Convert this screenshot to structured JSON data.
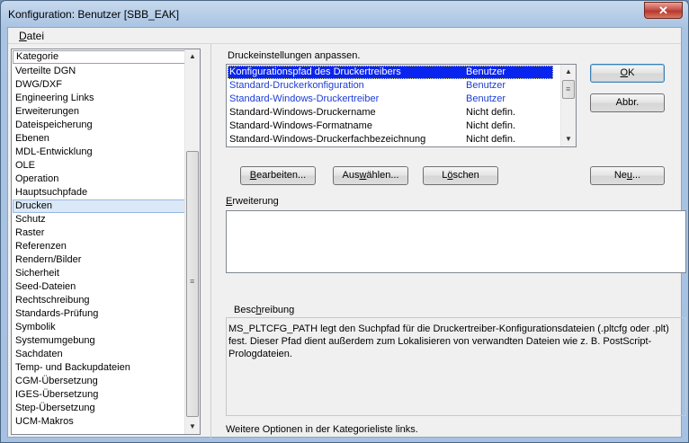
{
  "window": {
    "title": "Konfiguration: Benutzer [SBB_EAK]",
    "close_glyph": "✕"
  },
  "menu": {
    "file_mnemonic": "D",
    "file_rest": "atei"
  },
  "category": {
    "header": "Kategorie",
    "items": [
      "Verteilte DGN",
      "DWG/DXF",
      "Engineering Links",
      "Erweiterungen",
      "Dateispeicherung",
      "Ebenen",
      "MDL-Entwicklung",
      "OLE",
      "Operation",
      "Hauptsuchpfade",
      "Drucken",
      "Schutz",
      "Raster",
      "Referenzen",
      "Rendern/Bilder",
      "Sicherheit",
      "Seed-Dateien",
      "Rechtschreibung",
      "Standards-Prüfung",
      "Symbolik",
      "Systemumgebung",
      "Sachdaten",
      "Temp- und Backupdateien",
      "CGM-Übersetzung",
      "IGES-Übersetzung",
      "Step-Übersetzung",
      "UCM-Makros"
    ],
    "selected_index": 10
  },
  "settings": {
    "heading": "Druckeinstellungen anpassen.",
    "rows": [
      {
        "name": "Konfigurationspfad des Druckertreibers",
        "value": "Benutzer",
        "state": "selected"
      },
      {
        "name": "Standard-Druckerkonfiguration",
        "value": "Benutzer",
        "state": "blue"
      },
      {
        "name": "Standard-Windows-Druckertreiber",
        "value": "Benutzer",
        "state": "blue"
      },
      {
        "name": "Standard-Windows-Druckername",
        "value": "Nicht defin.",
        "state": "normal"
      },
      {
        "name": "Standard-Windows-Formatname",
        "value": "Nicht defin.",
        "state": "normal"
      },
      {
        "name": "Standard-Windows-Druckerfachbezeichnung",
        "value": "Nicht defin.",
        "state": "normal"
      }
    ]
  },
  "buttons": {
    "ok": {
      "m": "O",
      "rest": "K"
    },
    "cancel": "Abbr.",
    "edit": {
      "m": "B",
      "rest": "earbeiten..."
    },
    "select": {
      "pre": "Aus",
      "m": "w",
      "rest": "ählen..."
    },
    "delete": {
      "pre": "L",
      "m": "ö",
      "rest": "schen"
    },
    "new": {
      "pre": "Ne",
      "m": "u",
      "rest": "..."
    }
  },
  "extension": {
    "m": "E",
    "rest": "rweiterung"
  },
  "description": {
    "pre": "Besc",
    "m": "h",
    "rest": "reibung",
    "text": "MS_PLTCFG_PATH legt den Suchpfad für die Druckertreiber-Konfigurationsdateien (.pltcfg oder .plt) fest. Dieser Pfad dient außerdem zum Lokalisieren von verwandten Dateien wie z. B. PostScript-Prologdateien."
  },
  "footer": "Weitere Optionen in der Kategorieliste links."
}
